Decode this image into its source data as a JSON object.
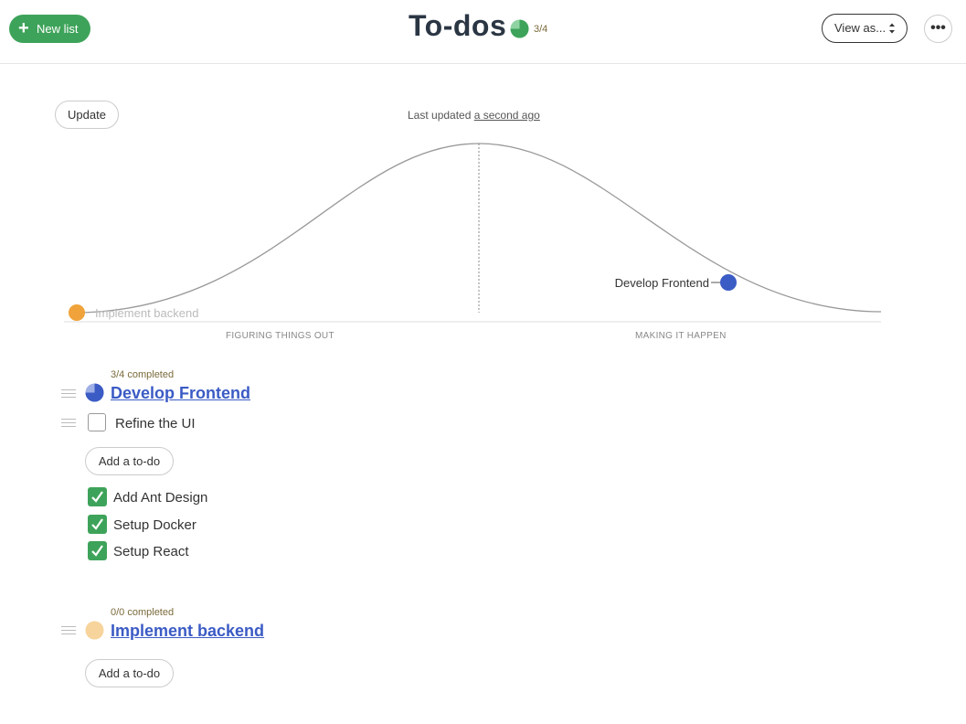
{
  "header": {
    "new_list_label": "New list",
    "title": "To-dos",
    "progress_count": "3/4",
    "progress_fraction": 0.75,
    "view_as_label": "View as...",
    "more_label": "•••"
  },
  "hill_chart": {
    "update_label": "Update",
    "last_updated_prefix": "Last updated",
    "last_updated_link": "a second ago",
    "left_section_label": "FIGURING THINGS OUT",
    "right_section_label": "MAKING IT HAPPEN",
    "points": [
      {
        "label": "Implement backend",
        "color": "#f0a33a"
      },
      {
        "label": "Develop Frontend",
        "color": "#3b5bc5"
      }
    ]
  },
  "lists": [
    {
      "completed_text": "3/4 completed",
      "title": "Develop Frontend",
      "color": "#3b5bc5",
      "progress_fraction": 0.75,
      "pending": [
        {
          "label": "Refine the UI"
        }
      ],
      "add_label": "Add a to-do",
      "done": [
        {
          "label": "Add Ant Design"
        },
        {
          "label": "Setup Docker"
        },
        {
          "label": "Setup React"
        }
      ]
    },
    {
      "completed_text": "0/0 completed",
      "title": "Implement backend",
      "color": "#f7d49b",
      "add_label": "Add a to-do"
    }
  ],
  "colors": {
    "accent_green": "#3ea35a",
    "link_blue": "#3b5bc5",
    "orange": "#f0a33a"
  }
}
